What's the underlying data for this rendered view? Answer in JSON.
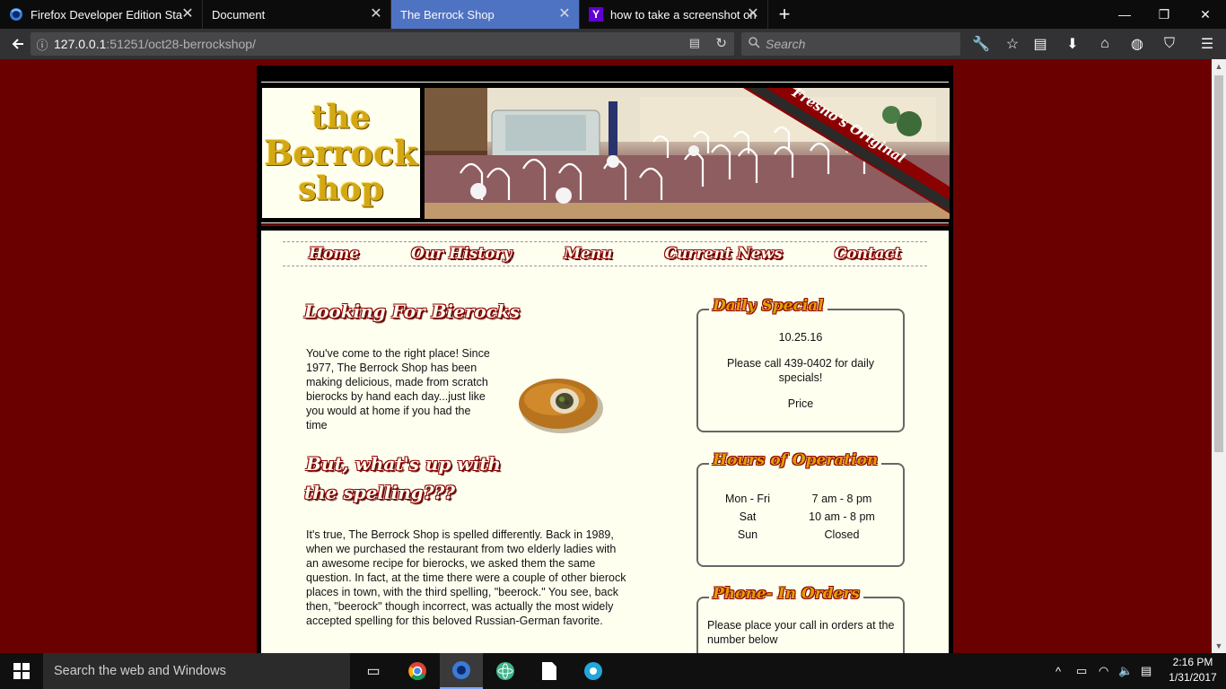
{
  "browser": {
    "tabs": [
      {
        "label": "Firefox Developer Edition Sta",
        "icon": "firefox-dev-icon"
      },
      {
        "label": "Document",
        "icon": ""
      },
      {
        "label": "The Berrock Shop",
        "icon": ""
      },
      {
        "label": "how to take a screenshot on",
        "icon": "yahoo-icon"
      }
    ],
    "active_tab_index": 2,
    "url_host": "127.0.0.1",
    "url_path": ":51251/oct28-berrockshop/",
    "search_placeholder": "Search",
    "accent_color": "#4f73c3"
  },
  "site": {
    "logo": {
      "line1": "the",
      "line2": "Berrock",
      "line3": "shop"
    },
    "banner_ribbon": "Fresno's Original",
    "menu": [
      "Home",
      "Our History",
      "Menu",
      "Current News",
      "Contact"
    ],
    "main": {
      "heading1": "Looking For Bierocks",
      "para1": "You've come to the right place! Since 1977, The Berrock Shop has been making delicious, made from scratch bierocks by hand each day...just like you would at home if you had the time",
      "heading2_line1": "But, what's up with",
      "heading2_line2": "the spelling???",
      "para2": "It's true, The Berrock Shop is spelled differently. Back in 1989, when we purchased the restaurant from two elderly ladies with an awesome recipe for bierocks, we asked them the same question. In fact, at the time there were a couple of other bierock places in town, with the third spelling, \"beerock.\" You see, back then, \"beerock\" though incorrect, was actually the most widely accepted spelling for this beloved Russian-German favorite."
    },
    "daily_special": {
      "title": "Daily Special",
      "date": "10.25.16",
      "text": "Please call 439-0402 for daily specials!",
      "price": "Price"
    },
    "hours": {
      "title": "Hours of Operation",
      "rows": [
        {
          "day": "Mon - Fri",
          "time": "7 am - 8 pm"
        },
        {
          "day": "Sat",
          "time": "10 am - 8 pm"
        },
        {
          "day": "Sun",
          "time": "Closed"
        }
      ]
    },
    "phone_orders": {
      "title": "Phone- In Orders",
      "text": "Please place your call in orders at the number below"
    },
    "colors": {
      "background": "#6b0000",
      "panel": "#fffff0",
      "gold": "#d4a812",
      "heading_outline": "#8b0000"
    }
  },
  "taskbar": {
    "search_placeholder": "Search the web and Windows",
    "time": "2:16 PM",
    "date": "1/31/2017"
  }
}
